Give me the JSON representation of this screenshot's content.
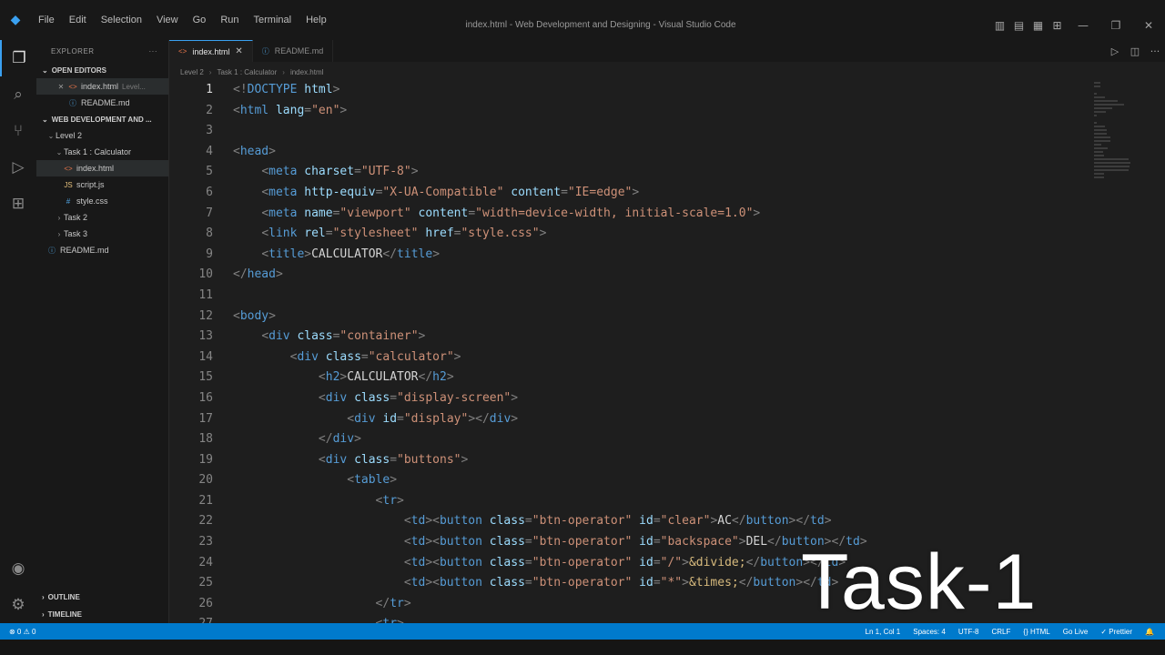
{
  "window": {
    "title": "index.html - Web Development and Designing - Visual Studio Code",
    "menu": [
      "File",
      "Edit",
      "Selection",
      "View",
      "Go",
      "Run",
      "Terminal",
      "Help"
    ]
  },
  "sidebar": {
    "header": "EXPLORER",
    "open_editors_label": "OPEN EDITORS",
    "open_editors": [
      {
        "name": "index.html",
        "hint": "Level..."
      },
      {
        "name": "README.md",
        "hint": ""
      }
    ],
    "workspace_label": "WEB DEVELOPMENT AND ...",
    "tree": [
      {
        "name": "Level 2",
        "depth": 1,
        "expanded": true
      },
      {
        "name": "Task 1 : Calculator",
        "depth": 2,
        "expanded": true
      },
      {
        "name": "index.html",
        "depth": 3
      },
      {
        "name": "script.js",
        "depth": 3
      },
      {
        "name": "style.css",
        "depth": 3
      },
      {
        "name": "Task 2",
        "depth": 2,
        "expanded": false
      },
      {
        "name": "Task 3",
        "depth": 2,
        "expanded": false
      },
      {
        "name": "README.md",
        "depth": 1
      }
    ],
    "outline_label": "OUTLINE",
    "timeline_label": "TIMELINE"
  },
  "tabs": [
    {
      "label": "index.html",
      "active": true
    },
    {
      "label": "README.md",
      "active": false
    }
  ],
  "breadcrumb": [
    "Level 2",
    "Task 1 : Calculator",
    "index.html"
  ],
  "code_lines": [
    [
      [
        "punc",
        "<!"
      ],
      [
        "tag",
        "DOCTYPE"
      ],
      [
        "text",
        " "
      ],
      [
        "attr",
        "html"
      ],
      [
        "punc",
        ">"
      ]
    ],
    [
      [
        "punc",
        "<"
      ],
      [
        "tag",
        "html"
      ],
      [
        "text",
        " "
      ],
      [
        "attr",
        "lang"
      ],
      [
        "punc",
        "="
      ],
      [
        "str",
        "\"en\""
      ],
      [
        "punc",
        ">"
      ]
    ],
    [],
    [
      [
        "punc",
        "<"
      ],
      [
        "tag",
        "head"
      ],
      [
        "punc",
        ">"
      ]
    ],
    [
      [
        "text",
        "    "
      ],
      [
        "punc",
        "<"
      ],
      [
        "tag",
        "meta"
      ],
      [
        "text",
        " "
      ],
      [
        "attr",
        "charset"
      ],
      [
        "punc",
        "="
      ],
      [
        "str",
        "\"UTF-8\""
      ],
      [
        "punc",
        ">"
      ]
    ],
    [
      [
        "text",
        "    "
      ],
      [
        "punc",
        "<"
      ],
      [
        "tag",
        "meta"
      ],
      [
        "text",
        " "
      ],
      [
        "attr",
        "http-equiv"
      ],
      [
        "punc",
        "="
      ],
      [
        "str",
        "\"X-UA-Compatible\""
      ],
      [
        "text",
        " "
      ],
      [
        "attr",
        "content"
      ],
      [
        "punc",
        "="
      ],
      [
        "str",
        "\"IE=edge\""
      ],
      [
        "punc",
        ">"
      ]
    ],
    [
      [
        "text",
        "    "
      ],
      [
        "punc",
        "<"
      ],
      [
        "tag",
        "meta"
      ],
      [
        "text",
        " "
      ],
      [
        "attr",
        "name"
      ],
      [
        "punc",
        "="
      ],
      [
        "str",
        "\"viewport\""
      ],
      [
        "text",
        " "
      ],
      [
        "attr",
        "content"
      ],
      [
        "punc",
        "="
      ],
      [
        "str",
        "\"width=device-width, initial-scale=1.0\""
      ],
      [
        "punc",
        ">"
      ]
    ],
    [
      [
        "text",
        "    "
      ],
      [
        "punc",
        "<"
      ],
      [
        "tag",
        "link"
      ],
      [
        "text",
        " "
      ],
      [
        "attr",
        "rel"
      ],
      [
        "punc",
        "="
      ],
      [
        "str",
        "\"stylesheet\""
      ],
      [
        "text",
        " "
      ],
      [
        "attr",
        "href"
      ],
      [
        "punc",
        "="
      ],
      [
        "str",
        "\"style.css\""
      ],
      [
        "punc",
        ">"
      ]
    ],
    [
      [
        "text",
        "    "
      ],
      [
        "punc",
        "<"
      ],
      [
        "tag",
        "title"
      ],
      [
        "punc",
        ">"
      ],
      [
        "text",
        "CALCULATOR"
      ],
      [
        "punc",
        "</"
      ],
      [
        "tag",
        "title"
      ],
      [
        "punc",
        ">"
      ]
    ],
    [
      [
        "punc",
        "</"
      ],
      [
        "tag",
        "head"
      ],
      [
        "punc",
        ">"
      ]
    ],
    [],
    [
      [
        "punc",
        "<"
      ],
      [
        "tag",
        "body"
      ],
      [
        "punc",
        ">"
      ]
    ],
    [
      [
        "text",
        "    "
      ],
      [
        "punc",
        "<"
      ],
      [
        "tag",
        "div"
      ],
      [
        "text",
        " "
      ],
      [
        "attr",
        "class"
      ],
      [
        "punc",
        "="
      ],
      [
        "str",
        "\"container\""
      ],
      [
        "punc",
        ">"
      ]
    ],
    [
      [
        "text",
        "        "
      ],
      [
        "punc",
        "<"
      ],
      [
        "tag",
        "div"
      ],
      [
        "text",
        " "
      ],
      [
        "attr",
        "class"
      ],
      [
        "punc",
        "="
      ],
      [
        "str",
        "\"calculator\""
      ],
      [
        "punc",
        ">"
      ]
    ],
    [
      [
        "text",
        "            "
      ],
      [
        "punc",
        "<"
      ],
      [
        "tag",
        "h2"
      ],
      [
        "punc",
        ">"
      ],
      [
        "text",
        "CALCULATOR"
      ],
      [
        "punc",
        "</"
      ],
      [
        "tag",
        "h2"
      ],
      [
        "punc",
        ">"
      ]
    ],
    [
      [
        "text",
        "            "
      ],
      [
        "punc",
        "<"
      ],
      [
        "tag",
        "div"
      ],
      [
        "text",
        " "
      ],
      [
        "attr",
        "class"
      ],
      [
        "punc",
        "="
      ],
      [
        "str",
        "\"display-screen\""
      ],
      [
        "punc",
        ">"
      ]
    ],
    [
      [
        "text",
        "                "
      ],
      [
        "punc",
        "<"
      ],
      [
        "tag",
        "div"
      ],
      [
        "text",
        " "
      ],
      [
        "attr",
        "id"
      ],
      [
        "punc",
        "="
      ],
      [
        "str",
        "\"display\""
      ],
      [
        "punc",
        "></"
      ],
      [
        "tag",
        "div"
      ],
      [
        "punc",
        ">"
      ]
    ],
    [
      [
        "text",
        "            "
      ],
      [
        "punc",
        "</"
      ],
      [
        "tag",
        "div"
      ],
      [
        "punc",
        ">"
      ]
    ],
    [
      [
        "text",
        "            "
      ],
      [
        "punc",
        "<"
      ],
      [
        "tag",
        "div"
      ],
      [
        "text",
        " "
      ],
      [
        "attr",
        "class"
      ],
      [
        "punc",
        "="
      ],
      [
        "str",
        "\"buttons\""
      ],
      [
        "punc",
        ">"
      ]
    ],
    [
      [
        "text",
        "                "
      ],
      [
        "punc",
        "<"
      ],
      [
        "tag",
        "table"
      ],
      [
        "punc",
        ">"
      ]
    ],
    [
      [
        "text",
        "                    "
      ],
      [
        "punc",
        "<"
      ],
      [
        "tag",
        "tr"
      ],
      [
        "punc",
        ">"
      ]
    ],
    [
      [
        "text",
        "                        "
      ],
      [
        "punc",
        "<"
      ],
      [
        "tag",
        "td"
      ],
      [
        "punc",
        "><"
      ],
      [
        "tag",
        "button"
      ],
      [
        "text",
        " "
      ],
      [
        "attr",
        "class"
      ],
      [
        "punc",
        "="
      ],
      [
        "str",
        "\"btn-operator\""
      ],
      [
        "text",
        " "
      ],
      [
        "attr",
        "id"
      ],
      [
        "punc",
        "="
      ],
      [
        "str",
        "\"clear\""
      ],
      [
        "punc",
        ">"
      ],
      [
        "text",
        "AC"
      ],
      [
        "punc",
        "</"
      ],
      [
        "tag",
        "button"
      ],
      [
        "punc",
        "></"
      ],
      [
        "tag",
        "td"
      ],
      [
        "punc",
        ">"
      ]
    ],
    [
      [
        "text",
        "                        "
      ],
      [
        "punc",
        "<"
      ],
      [
        "tag",
        "td"
      ],
      [
        "punc",
        "><"
      ],
      [
        "tag",
        "button"
      ],
      [
        "text",
        " "
      ],
      [
        "attr",
        "class"
      ],
      [
        "punc",
        "="
      ],
      [
        "str",
        "\"btn-operator\""
      ],
      [
        "text",
        " "
      ],
      [
        "attr",
        "id"
      ],
      [
        "punc",
        "="
      ],
      [
        "str",
        "\"backspace\""
      ],
      [
        "punc",
        ">"
      ],
      [
        "text",
        "DEL"
      ],
      [
        "punc",
        "</"
      ],
      [
        "tag",
        "button"
      ],
      [
        "punc",
        "></"
      ],
      [
        "tag",
        "td"
      ],
      [
        "punc",
        ">"
      ]
    ],
    [
      [
        "text",
        "                        "
      ],
      [
        "punc",
        "<"
      ],
      [
        "tag",
        "td"
      ],
      [
        "punc",
        "><"
      ],
      [
        "tag",
        "button"
      ],
      [
        "text",
        " "
      ],
      [
        "attr",
        "class"
      ],
      [
        "punc",
        "="
      ],
      [
        "str",
        "\"btn-operator\""
      ],
      [
        "text",
        " "
      ],
      [
        "attr",
        "id"
      ],
      [
        "punc",
        "="
      ],
      [
        "str",
        "\"/\""
      ],
      [
        "punc",
        ">"
      ],
      [
        "ent",
        "&divide;"
      ],
      [
        "punc",
        "</"
      ],
      [
        "tag",
        "button"
      ],
      [
        "punc",
        "></"
      ],
      [
        "tag",
        "td"
      ],
      [
        "punc",
        ">"
      ]
    ],
    [
      [
        "text",
        "                        "
      ],
      [
        "punc",
        "<"
      ],
      [
        "tag",
        "td"
      ],
      [
        "punc",
        "><"
      ],
      [
        "tag",
        "button"
      ],
      [
        "text",
        " "
      ],
      [
        "attr",
        "class"
      ],
      [
        "punc",
        "="
      ],
      [
        "str",
        "\"btn-operator\""
      ],
      [
        "text",
        " "
      ],
      [
        "attr",
        "id"
      ],
      [
        "punc",
        "="
      ],
      [
        "str",
        "\"*\""
      ],
      [
        "punc",
        ">"
      ],
      [
        "ent",
        "&times;"
      ],
      [
        "punc",
        "</"
      ],
      [
        "tag",
        "button"
      ],
      [
        "punc",
        "></"
      ],
      [
        "tag",
        "td"
      ],
      [
        "punc",
        ">"
      ]
    ],
    [
      [
        "text",
        "                    "
      ],
      [
        "punc",
        "</"
      ],
      [
        "tag",
        "tr"
      ],
      [
        "punc",
        ">"
      ]
    ],
    [
      [
        "text",
        "                    "
      ],
      [
        "punc",
        "<"
      ],
      [
        "tag",
        "tr"
      ],
      [
        "punc",
        ">"
      ]
    ]
  ],
  "current_line": 1,
  "overlay": {
    "text": "Task-1"
  },
  "statusbar": {
    "left": [
      "⊗ 0 ⚠ 0"
    ],
    "right": [
      "Ln 1, Col 1",
      "Spaces: 4",
      "UTF-8",
      "CRLF",
      "{} HTML",
      "Go Live",
      "✓ Prettier"
    ]
  }
}
